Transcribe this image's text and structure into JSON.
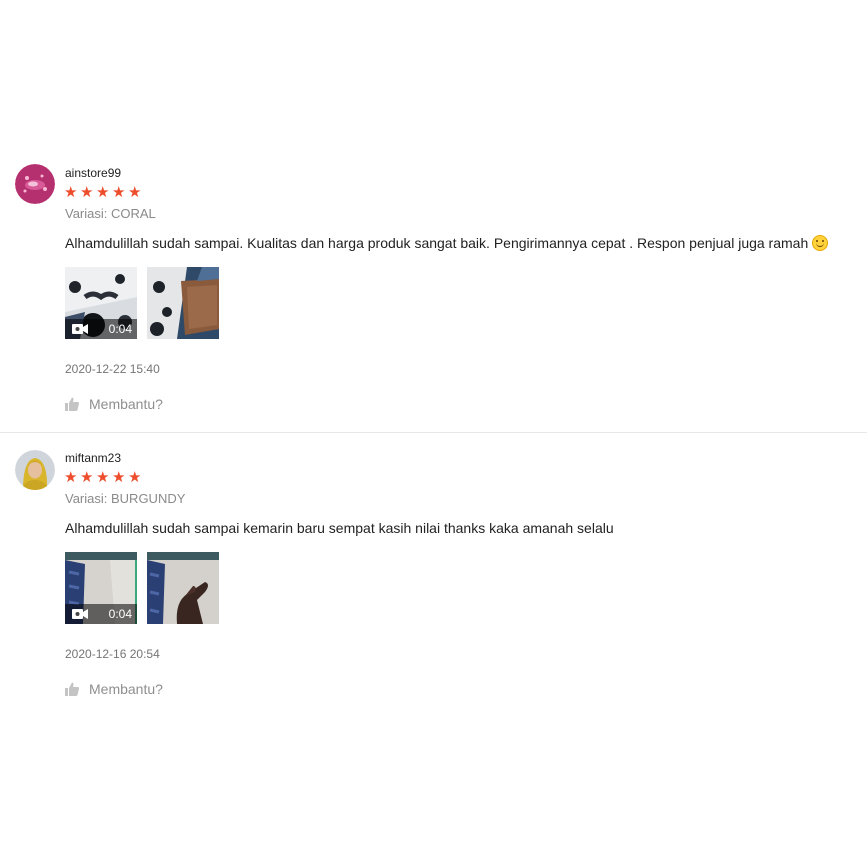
{
  "reviews": [
    {
      "username": "ainstore99",
      "rating": 5,
      "variation": "Variasi: CORAL",
      "comment": "Alhamdulillah sudah sampai. Kualitas dan harga produk sangat baik. Pengirimannya cepat . Respon penjual juga ramah",
      "video_duration": "0:04",
      "date": "2020-12-22 15:40",
      "helpful_label": "Membantu?"
    },
    {
      "username": "miftanm23",
      "rating": 5,
      "variation": "Variasi: BURGUNDY",
      "comment": "Alhamdulillah sudah sampai kemarin baru sempat kasih nilai thanks kaka amanah selalu",
      "video_duration": "0:04",
      "date": "2020-12-16 20:54",
      "helpful_label": "Membantu?"
    }
  ],
  "colors": {
    "star": "#ee4d2d",
    "muted": "#8a8a8a",
    "divider": "#e8e8e8"
  },
  "icons": {
    "star": "star-icon",
    "video": "video-camera-icon",
    "like": "thumbs-up-icon",
    "emoji": "smiling-face-icon"
  }
}
